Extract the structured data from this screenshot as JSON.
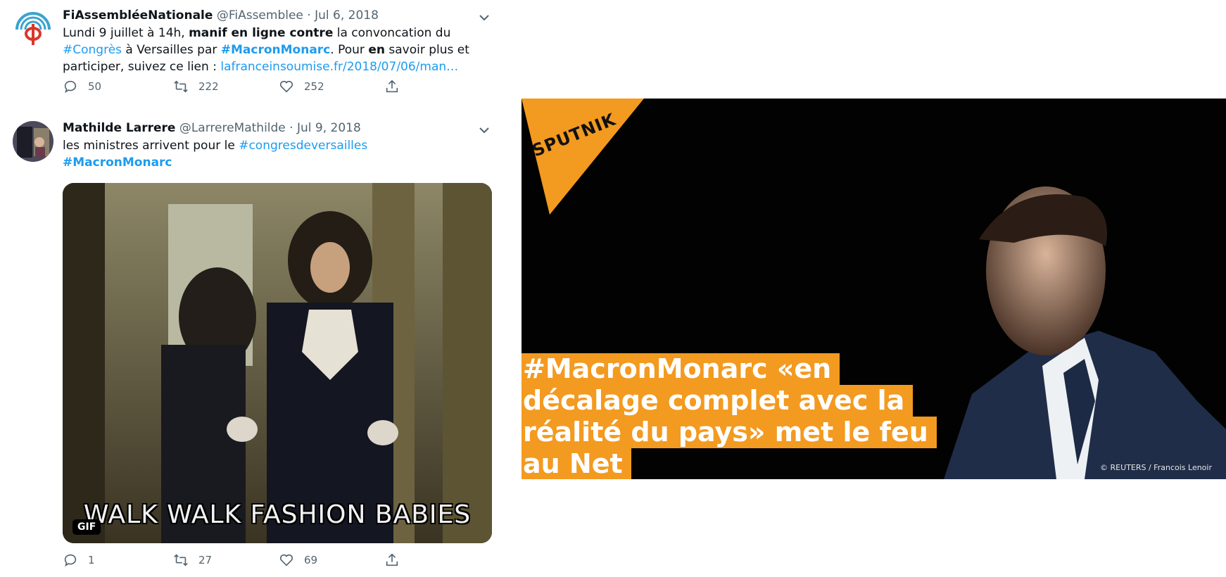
{
  "tweets": [
    {
      "name": "FiAssembléeNationale",
      "handle": "@FiAssemblee",
      "date": "Jul 6, 2018",
      "text": {
        "p1": "Lundi 9 juillet à 14h, ",
        "b1": "manif en ligne contre",
        "p2": " la convoncation du ",
        "tag1": "#Congrès",
        "p3": " à Versailles par ",
        "tag2": "#MacronMonarc",
        "p4": ". Pour ",
        "b2": "en",
        "p5": " savoir plus et participer, suivez ce lien : ",
        "link": "lafranceinsoumise.fr/2018/07/06/man…"
      },
      "replies": "50",
      "retweets": "222",
      "likes": "252"
    },
    {
      "name": "Mathilde Larrere",
      "handle": "@LarrereMathilde",
      "date": "Jul 9, 2018",
      "text": {
        "p1": "les ministres arrivent pour le ",
        "tag1": "#congresdeversailles",
        "tag2": "#MacronMonarc"
      },
      "gif_caption": "WALK WALK FASHION BABIES",
      "gif_badge": "GIF",
      "replies": "1",
      "retweets": "27",
      "likes": "69"
    }
  ],
  "card": {
    "logo": "SPUTNIK",
    "headline_lines": [
      "#MacronMonarc «en",
      "décalage complet avec la",
      "réalité du pays» met le feu",
      "au Net"
    ],
    "credit": "© REUTERS / Francois Lenoir"
  },
  "icons": [
    "reply-icon",
    "retweet-icon",
    "like-icon",
    "share-icon",
    "chevron-down-icon"
  ],
  "colors": {
    "link": "#1d9bf0",
    "muted": "#536471",
    "sputnik_orange": "#f39a20"
  }
}
